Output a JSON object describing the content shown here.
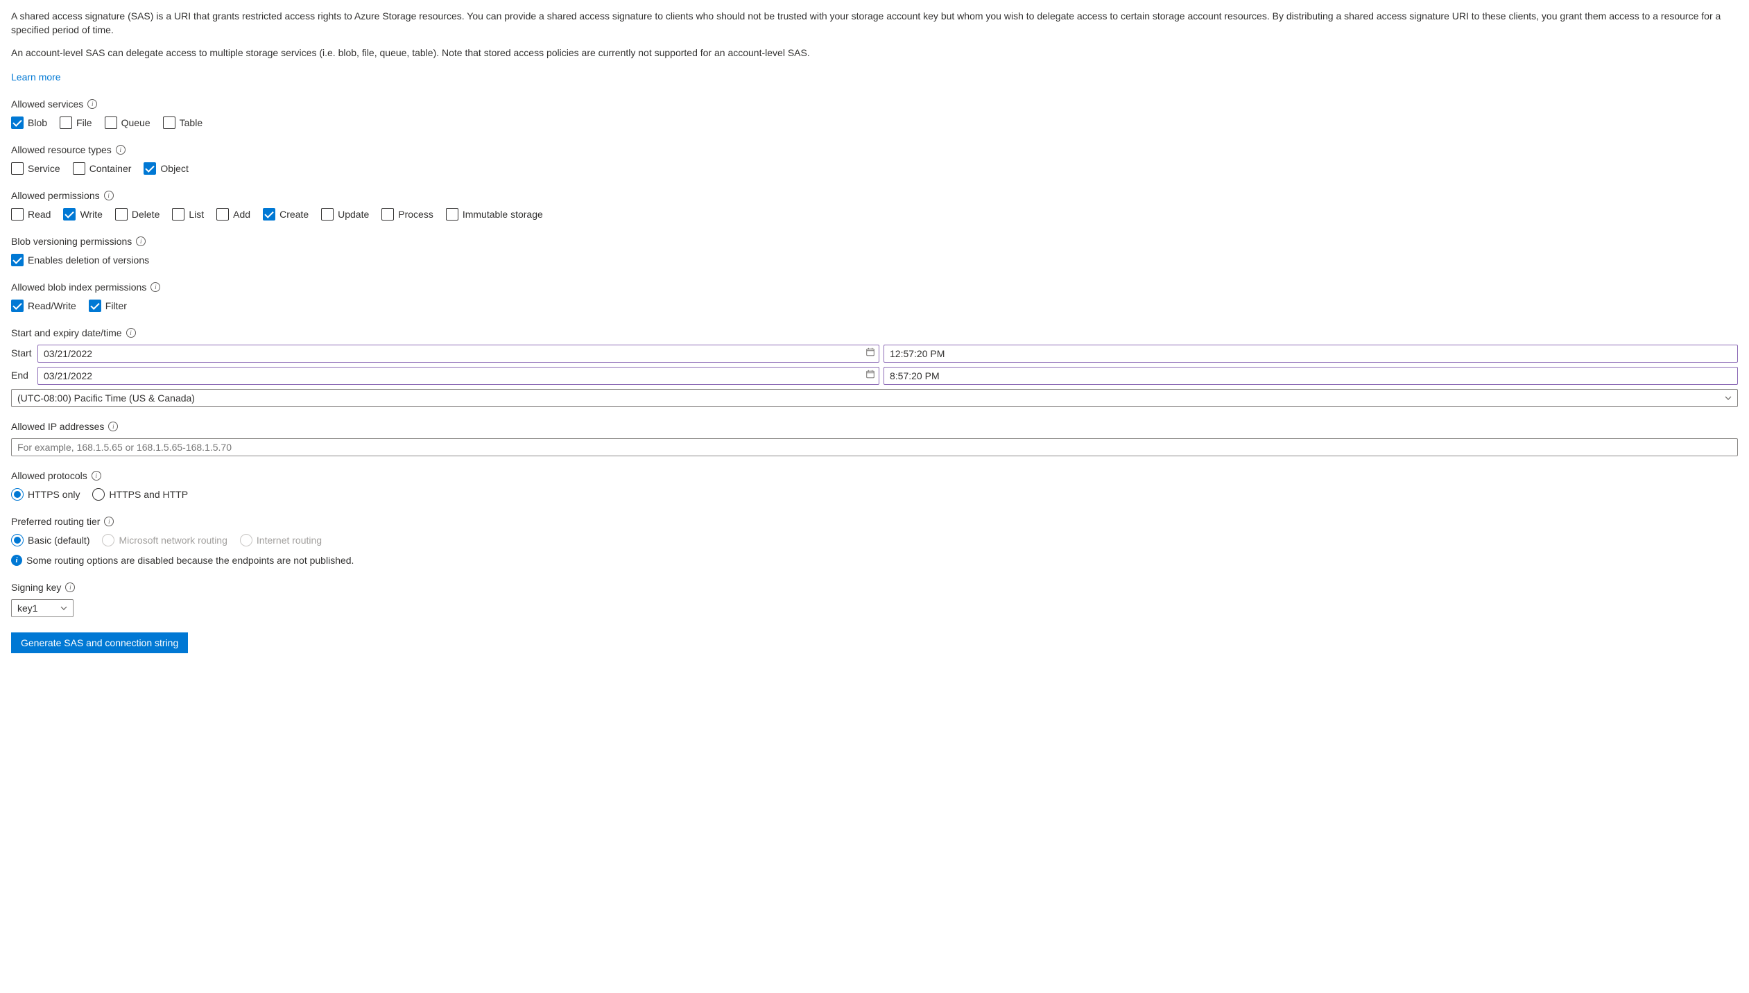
{
  "intro": {
    "p1": "A shared access signature (SAS) is a URI that grants restricted access rights to Azure Storage resources. You can provide a shared access signature to clients who should not be trusted with your storage account key but whom you wish to delegate access to certain storage account resources. By distributing a shared access signature URI to these clients, you grant them access to a resource for a specified period of time.",
    "p2": "An account-level SAS can delegate access to multiple storage services (i.e. blob, file, queue, table). Note that stored access policies are currently not supported for an account-level SAS.",
    "learn_more": "Learn more"
  },
  "services": {
    "label": "Allowed services",
    "items": [
      {
        "label": "Blob",
        "checked": true
      },
      {
        "label": "File",
        "checked": false
      },
      {
        "label": "Queue",
        "checked": false
      },
      {
        "label": "Table",
        "checked": false
      }
    ]
  },
  "resource_types": {
    "label": "Allowed resource types",
    "items": [
      {
        "label": "Service",
        "checked": false
      },
      {
        "label": "Container",
        "checked": false
      },
      {
        "label": "Object",
        "checked": true
      }
    ]
  },
  "permissions": {
    "label": "Allowed permissions",
    "items": [
      {
        "label": "Read",
        "checked": false
      },
      {
        "label": "Write",
        "checked": true
      },
      {
        "label": "Delete",
        "checked": false
      },
      {
        "label": "List",
        "checked": false
      },
      {
        "label": "Add",
        "checked": false
      },
      {
        "label": "Create",
        "checked": true
      },
      {
        "label": "Update",
        "checked": false
      },
      {
        "label": "Process",
        "checked": false
      },
      {
        "label": "Immutable storage",
        "checked": false
      }
    ]
  },
  "blob_versioning": {
    "label": "Blob versioning permissions",
    "items": [
      {
        "label": "Enables deletion of versions",
        "checked": true
      }
    ]
  },
  "blob_index": {
    "label": "Allowed blob index permissions",
    "items": [
      {
        "label": "Read/Write",
        "checked": true
      },
      {
        "label": "Filter",
        "checked": true
      }
    ]
  },
  "datetime": {
    "label": "Start and expiry date/time",
    "start_label": "Start",
    "end_label": "End",
    "start_date": "03/21/2022",
    "start_time": "12:57:20 PM",
    "end_date": "03/21/2022",
    "end_time": "8:57:20 PM",
    "timezone": "(UTC-08:00) Pacific Time (US & Canada)"
  },
  "ip": {
    "label": "Allowed IP addresses",
    "placeholder": "For example, 168.1.5.65 or 168.1.5.65-168.1.5.70"
  },
  "protocols": {
    "label": "Allowed protocols",
    "items": [
      {
        "label": "HTTPS only",
        "selected": true
      },
      {
        "label": "HTTPS and HTTP",
        "selected": false
      }
    ]
  },
  "routing": {
    "label": "Preferred routing tier",
    "items": [
      {
        "label": "Basic (default)",
        "selected": true,
        "disabled": false
      },
      {
        "label": "Microsoft network routing",
        "selected": false,
        "disabled": true
      },
      {
        "label": "Internet routing",
        "selected": false,
        "disabled": true
      }
    ],
    "info": "Some routing options are disabled because the endpoints are not published."
  },
  "signing": {
    "label": "Signing key",
    "value": "key1"
  },
  "generate_button": "Generate SAS and connection string"
}
